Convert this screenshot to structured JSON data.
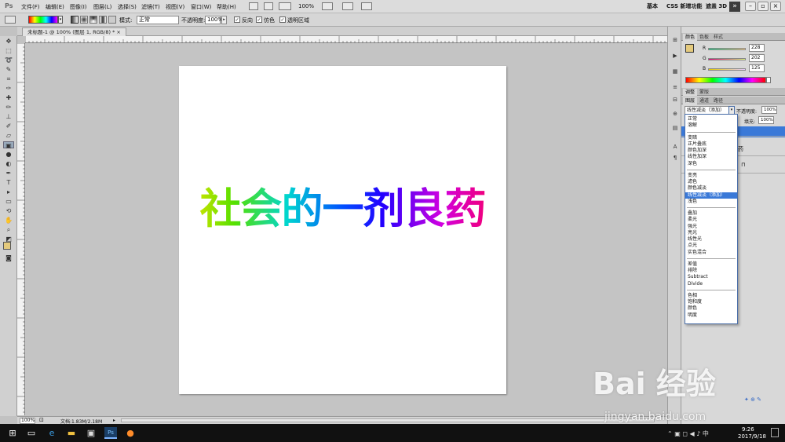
{
  "app": {
    "logo": "Ps"
  },
  "menu": [
    "文件(F)",
    "编辑(E)",
    "图像(I)",
    "图层(L)",
    "选择(S)",
    "滤镜(T)",
    "视图(V)",
    "窗口(W)",
    "帮助(H)"
  ],
  "menu_zoom": "100%",
  "workspaces": [
    "基本",
    "CSS 新增功能",
    "遮盖 3D"
  ],
  "options": {
    "mode_label": "模式:",
    "mode_value": "正常",
    "opacity_label": "不透明度:",
    "opacity_value": "100%",
    "reverse": "反向",
    "dither": "仿色",
    "transparency": "透明区域"
  },
  "document": {
    "tab_title": "未标题-1 @ 100% (图层 1, RGB/8) *",
    "text": "社会的一剂良药"
  },
  "status": {
    "zoom": "100%",
    "doc": "文档:1.83M/2.18M"
  },
  "color_panel": {
    "tabs": [
      "颜色",
      "色板",
      "样式"
    ],
    "r_label": "R",
    "g_label": "G",
    "b_label": "B",
    "r": "228",
    "g": "202",
    "b": "125",
    "fg": "#e4ca7d"
  },
  "adjust_panel": {
    "tabs": [
      "调整",
      "蒙版"
    ]
  },
  "layers_panel": {
    "tabs": [
      "图层",
      "通道",
      "路径"
    ],
    "blend_value": "线性减淡（添加）",
    "opacity_label": "不透明度:",
    "opacity_value": "100%",
    "fill_label": "填充:",
    "fill_value": "100%",
    "layer_name_partial": "药"
  },
  "blend_modes": [
    [
      "正常",
      "溶解"
    ],
    [
      "变暗",
      "正片叠底",
      "颜色加深",
      "线性加深",
      "深色"
    ],
    [
      "变亮",
      "滤色",
      "颜色减淡",
      "线性减淡（添加）",
      "浅色"
    ],
    [
      "叠加",
      "柔光",
      "强光",
      "亮光",
      "线性光",
      "点光",
      "实色混合"
    ],
    [
      "差值",
      "排除",
      "Subtract",
      "Divide"
    ],
    [
      "色相",
      "饱和度",
      "颜色",
      "明度"
    ]
  ],
  "highlighted_mode": "线性减淡（添加）",
  "taskbar": {
    "time": "9:26",
    "date": "2017/9/18"
  },
  "watermark": {
    "main": "Bai 经验",
    "sub": "jingyan.baidu.com"
  }
}
